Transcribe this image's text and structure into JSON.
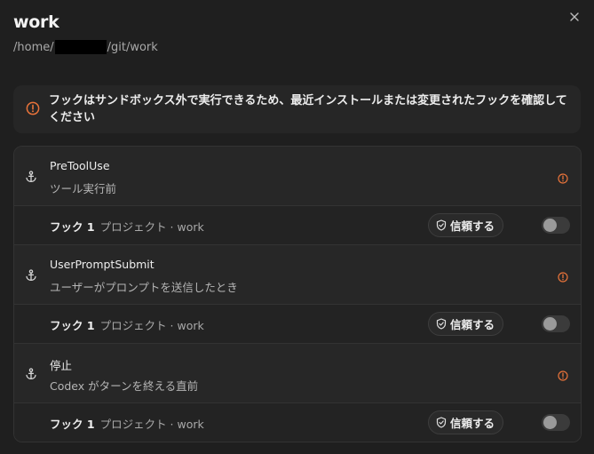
{
  "header": {
    "title": "work",
    "path_prefix": "/home/",
    "path_suffix": "/git/work"
  },
  "warning": {
    "text": "フックはサンドボックス外で実行できるため、最近インストールまたは変更されたフックを確認してください"
  },
  "events": [
    {
      "name": "PreToolUse",
      "description": "ツール実行前",
      "hook": {
        "label": "フック 1",
        "meta": "プロジェクト · work",
        "trust_label": "信頼する",
        "enabled": false
      }
    },
    {
      "name": "UserPromptSubmit",
      "description": "ユーザーがプロンプトを送信したとき",
      "hook": {
        "label": "フック 1",
        "meta": "プロジェクト · work",
        "trust_label": "信頼する",
        "enabled": false
      }
    },
    {
      "name": "停止",
      "description": "Codex がターンを終える直前",
      "hook": {
        "label": "フック 1",
        "meta": "プロジェクト · work",
        "trust_label": "信頼する",
        "enabled": false
      }
    }
  ],
  "colors": {
    "warning_accent": "#e8733a",
    "background": "#1f1f1f"
  },
  "icons": {
    "close": "close-icon",
    "warning": "warning-circle-icon",
    "event": "anchor-icon",
    "info": "info-circle-icon",
    "trust": "shield-check-icon"
  }
}
